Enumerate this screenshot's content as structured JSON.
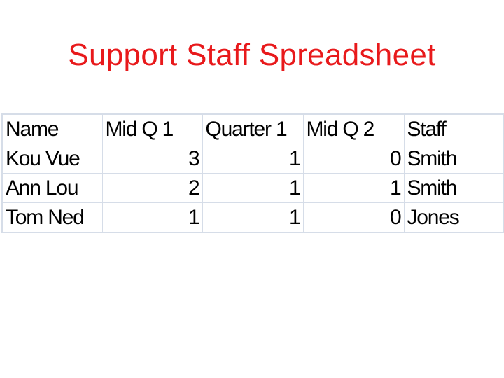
{
  "title": "Support Staff Spreadsheet",
  "table": {
    "headers": [
      "Name",
      "Mid Q 1",
      "Quarter 1",
      "Mid Q 2",
      "Staff"
    ],
    "rows": [
      [
        "Kou Vue",
        "3",
        "1",
        "0",
        "Smith"
      ],
      [
        "Ann Lou",
        "2",
        "1",
        "1",
        "Smith"
      ],
      [
        "Tom Ned",
        "1",
        "1",
        "0",
        "Jones"
      ]
    ]
  },
  "colors": {
    "title": "#e8191b",
    "grid": "#d6dde8"
  }
}
